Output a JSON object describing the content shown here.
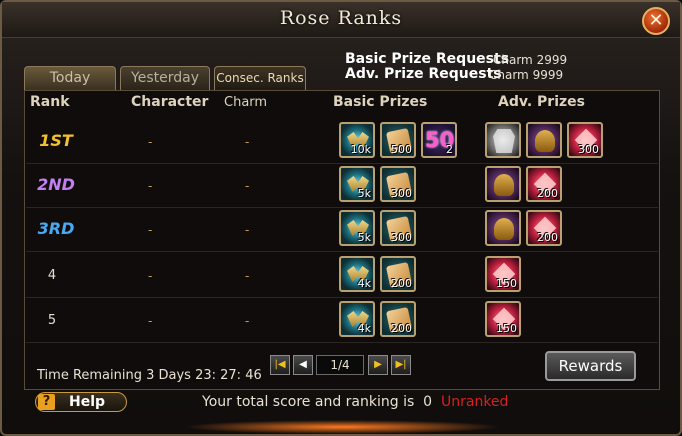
{
  "window": {
    "title": "Rose Ranks"
  },
  "tabs": [
    {
      "label": "Today"
    },
    {
      "label": "Yesterday"
    },
    {
      "label": "Consec. Ranks"
    }
  ],
  "requests": {
    "basic_label": "Basic Prize Requests",
    "basic_value": "Charm 2999",
    "adv_label": "Adv. Prize Requests",
    "adv_value": "Charm 9999"
  },
  "headers": {
    "rank": "Rank",
    "character": "Character",
    "charm": "Charm",
    "basic": "Basic Prizes",
    "adv": "Adv. Prizes"
  },
  "rows": [
    {
      "rank": "1ST",
      "rank_color": "#f2c030",
      "character": "-",
      "charm": "-",
      "basic": [
        {
          "icon": "wings-icon",
          "count": "10k"
        },
        {
          "icon": "scroll-icon",
          "count": "500"
        },
        {
          "icon": "fifty-icon",
          "label": "50",
          "count": "2"
        }
      ],
      "adv": [
        {
          "icon": "armor-icon",
          "count": ""
        },
        {
          "icon": "helm-icon",
          "count": ""
        },
        {
          "icon": "gem-icon",
          "count": "300"
        }
      ]
    },
    {
      "rank": "2ND",
      "rank_color": "#c080f0",
      "character": "-",
      "charm": "-",
      "basic": [
        {
          "icon": "wings-icon",
          "count": "5k"
        },
        {
          "icon": "scroll-icon",
          "count": "300"
        }
      ],
      "adv": [
        {
          "icon": "helm-icon",
          "count": ""
        },
        {
          "icon": "gem-icon",
          "count": "200"
        }
      ]
    },
    {
      "rank": "3RD",
      "rank_color": "#4aa8f0",
      "character": "-",
      "charm": "-",
      "basic": [
        {
          "icon": "wings-icon",
          "count": "5k"
        },
        {
          "icon": "scroll-icon",
          "count": "300"
        }
      ],
      "adv": [
        {
          "icon": "helm-icon",
          "count": ""
        },
        {
          "icon": "gem-icon",
          "count": "200"
        }
      ]
    },
    {
      "rank": "4",
      "character": "-",
      "charm": "-",
      "basic": [
        {
          "icon": "wings-icon",
          "count": "4k"
        },
        {
          "icon": "scroll-icon",
          "count": "200"
        }
      ],
      "adv": [
        {
          "icon": "gem-icon",
          "count": "150"
        }
      ]
    },
    {
      "rank": "5",
      "character": "-",
      "charm": "-",
      "basic": [
        {
          "icon": "wings-icon",
          "count": "4k"
        },
        {
          "icon": "scroll-icon",
          "count": "200"
        }
      ],
      "adv": [
        {
          "icon": "gem-icon",
          "count": "150"
        }
      ]
    }
  ],
  "pager": {
    "page": "1/4",
    "first_icon": "first-page-icon",
    "prev_icon": "prev-page-icon",
    "next_icon": "next-page-icon",
    "last_icon": "last-page-icon"
  },
  "time_remaining": "Time Remaining 3 Days  23: 27: 46",
  "rewards_label": "Rewards",
  "help_label": "Help",
  "footer": {
    "text": "Your total score and ranking is",
    "score": "0",
    "status": "Unranked"
  }
}
